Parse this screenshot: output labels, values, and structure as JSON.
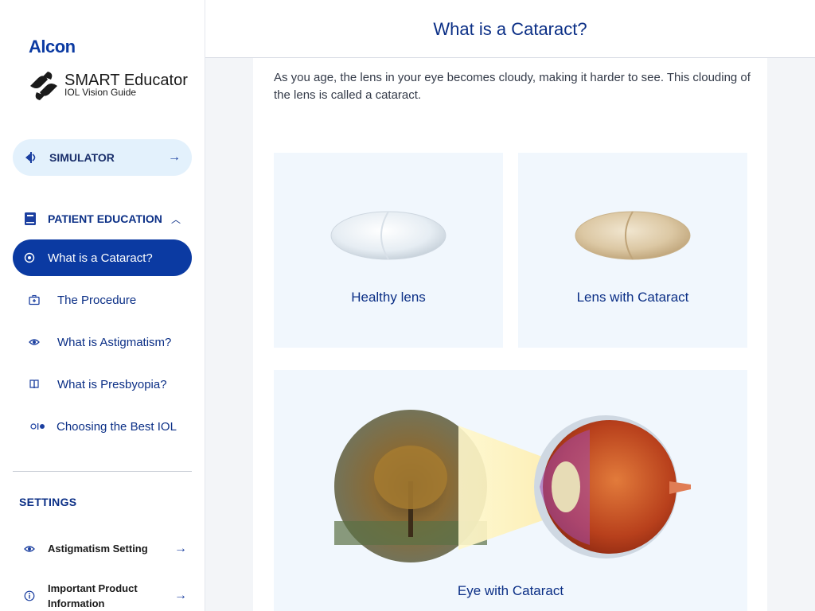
{
  "app": {
    "brand": "Alcon",
    "product_title": "SMART Educator",
    "product_subtitle": "IOL Vision Guide"
  },
  "sidebar": {
    "simulator_label": "SIMULATOR",
    "patient_education_label": "PATIENT EDUCATION",
    "nav_items": [
      {
        "label": "What is a Cataract?",
        "icon": "target-icon",
        "active": true
      },
      {
        "label": "The Procedure",
        "icon": "medical-kit-icon",
        "active": false
      },
      {
        "label": "What is Astigmatism?",
        "icon": "eye-icon",
        "active": false
      },
      {
        "label": "What is Presbyopia?",
        "icon": "book-icon",
        "active": false
      },
      {
        "label": "Choosing the Best IOL",
        "icon": "lens-compare-icon",
        "active": false
      }
    ],
    "settings_title": "SETTINGS",
    "settings_items": [
      {
        "label": "Astigmatism Setting",
        "icon": "eye-icon"
      },
      {
        "label": "Important Product Information",
        "icon": "info-icon"
      }
    ]
  },
  "page": {
    "title": "What is a Cataract?",
    "intro": "As you age, the lens in your eye becomes cloudy, making it harder to see. This clouding of the lens is called a cataract.",
    "cards": [
      {
        "caption": "Healthy lens"
      },
      {
        "caption": "Lens with Cataract"
      },
      {
        "caption": "Eye with Cataract"
      }
    ]
  },
  "colors": {
    "primary": "#0b3aa2",
    "nav_text": "#0b2f86",
    "simulator_bg": "#e3f1fc",
    "card_bg": "#f1f7fd"
  }
}
